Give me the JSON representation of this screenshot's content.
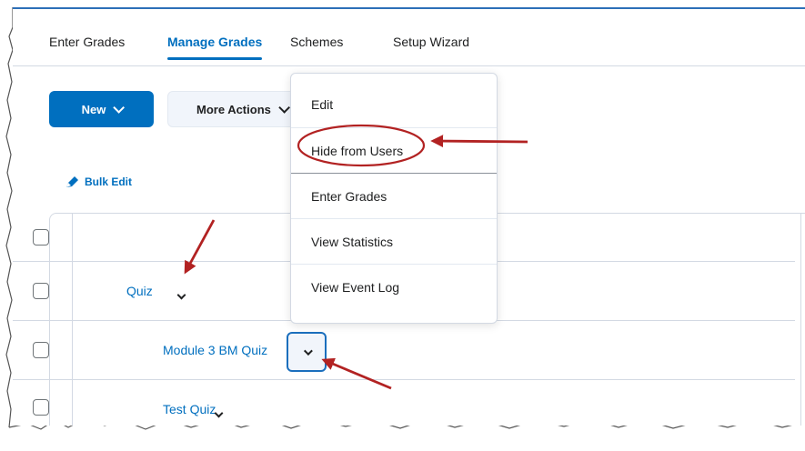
{
  "tabs": [
    {
      "label": "Enter Grades",
      "active": false
    },
    {
      "label": "Manage Grades",
      "active": true
    },
    {
      "label": "Schemes",
      "active": false
    },
    {
      "label": "Setup Wizard",
      "active": false
    }
  ],
  "toolbar": {
    "new_label": "New",
    "more_actions_label": "More Actions",
    "bulk_edit_label": "Bulk Edit"
  },
  "table": {
    "rows": [
      {
        "label": ""
      },
      {
        "label": "Quiz"
      },
      {
        "label": "Module 3 BM Quiz"
      },
      {
        "label": "Test Quiz"
      }
    ]
  },
  "menu": {
    "items": [
      {
        "label": "Edit"
      },
      {
        "label": "Hide from Users"
      },
      {
        "label": "Enter Grades"
      },
      {
        "label": "View Statistics"
      },
      {
        "label": "View Event Log"
      }
    ]
  },
  "colors": {
    "accent": "#006fbf",
    "annotation": "#b22222",
    "border": "#d3d9e3"
  }
}
